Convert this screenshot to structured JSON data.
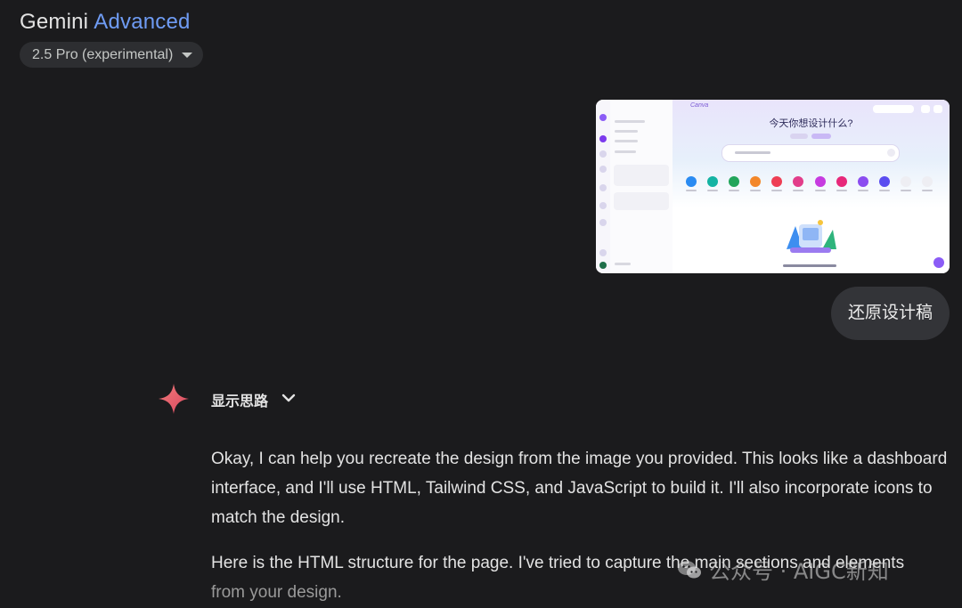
{
  "header": {
    "title_primary": "Gemini",
    "title_accent": "Advanced",
    "model_selector": "2.5 Pro (experimental)"
  },
  "user_message": {
    "attachment": {
      "headline": "今天你想设计什么?",
      "logo": "Canva"
    },
    "text": "还原设计稿"
  },
  "response": {
    "thinking_toggle": "显示思路",
    "paragraph_1": "Okay, I can help you recreate the design from the image you provided. This looks like a dashboard interface, and I'll use HTML, Tailwind CSS, and JavaScript to build it. I'll also incorporate icons to match the design.",
    "paragraph_2_main": "Here is the HTML structure for the page. I've tried to capture the main sections and elements",
    "paragraph_2_fade": "from your design."
  },
  "watermark": {
    "text": "公众号 · AIGC新知"
  },
  "colors": {
    "background": "#1b1b1d",
    "accent": "#6f9cf4",
    "sparkle": "#e8666b",
    "bubble": "#333438",
    "canva_purple": "#8b5cf6"
  },
  "icons": [
    "chevron-down-icon",
    "gemini-sparkle-icon",
    "wechat-icon"
  ]
}
